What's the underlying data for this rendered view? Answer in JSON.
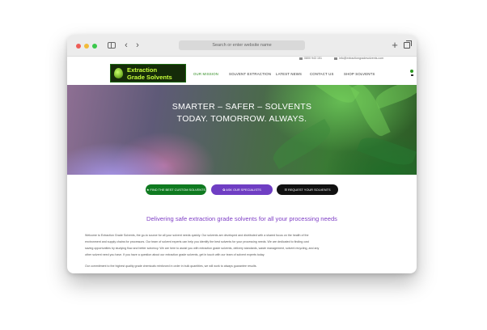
{
  "browser": {
    "address_placeholder": "Search or enter website name",
    "back_glyph": "‹",
    "forward_glyph": "›",
    "plus_glyph": "+"
  },
  "topbar": {
    "phone": "0800 943 151",
    "email": "info@extractiongradesolvents.com"
  },
  "logo": {
    "line1": "Extraction",
    "line2": "Grade Solvents"
  },
  "nav": {
    "items": [
      "OUR MISSION",
      "SOLVENT EXTRACTION",
      "LATEST NEWS",
      "CONTACT US",
      "SHOP SOLVENTS"
    ]
  },
  "hero": {
    "line1": "SMARTER – SAFER – SOLVENTS",
    "line2": "TODAY. TOMORROW. ALWAYS."
  },
  "buttons": [
    "★ FIND THE BEST CUSTOM SOLVENTS",
    "✿ ASK OUR SPECIALISTS",
    "☰ REQUEST YOUR SOLVENTS"
  ],
  "main": {
    "heading": "Delivering safe extraction grade solvents for all your processing needs",
    "paragraph_lines": [
      "Welcome to Extraction Grade Solvents, the go-to source for all your solvent needs quickly. Our solvents are developed and distributed with a shared focus on the health of the",
      "environment and supply chains for processors. Our team of solvent experts can help you identify the best solvents for your processing needs. We are dedicated to finding cost",
      "saving opportunities by studying flow and better solvency. We are here to assist you with extraction grade solvents, delivery standards, waste management, solvent recycling, and any",
      "other solvent need you have. If you have a question about our extraction grade solvents, get in touch with our team of solvent experts today."
    ],
    "paragraph_last": "Our commitment to the highest quality grade chemicals reinforced in order in bulk quantities, we will work to always guarantee results."
  },
  "colors": {
    "brand_green": "#2d8a1e",
    "accent_purple": "#7f3fc6",
    "logo_bg": "#152b09",
    "logo_text": "#c8ff3a"
  }
}
